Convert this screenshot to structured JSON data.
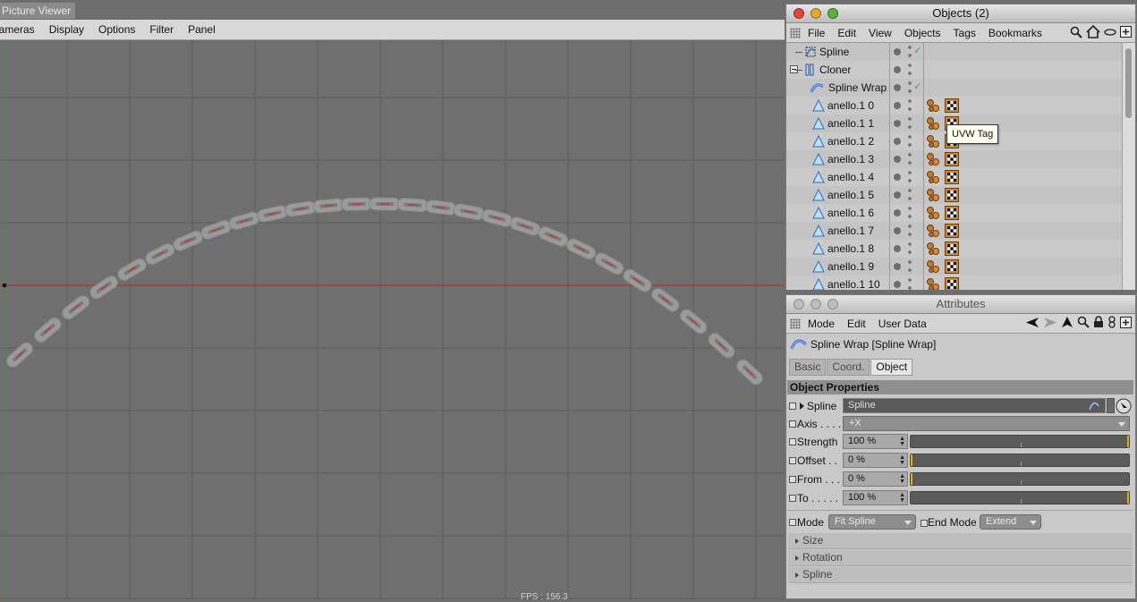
{
  "viewer": {
    "tab": "Picture Viewer",
    "fps": "FPS : 156.3"
  },
  "viewport_menu": [
    "Cameras",
    "Display",
    "Options",
    "Filter",
    "Panel"
  ],
  "objects_panel": {
    "title": "Objects (2)",
    "menu": [
      "File",
      "Edit",
      "View",
      "Objects",
      "Tags",
      "Bookmarks"
    ],
    "items": [
      {
        "name": "Spline",
        "icon": "spline-icon",
        "check": "✓"
      },
      {
        "name": "Cloner",
        "icon": "cloner-icon",
        "check": ""
      },
      {
        "name": "Spline Wrap",
        "icon": "spline-wrap-icon",
        "check": "✓"
      },
      {
        "name": "anello.1 0",
        "icon": "polygon-object-icon"
      },
      {
        "name": "anello.1 1",
        "icon": "polygon-object-icon"
      },
      {
        "name": "anello.1 2",
        "icon": "polygon-object-icon"
      },
      {
        "name": "anello.1 3",
        "icon": "polygon-object-icon"
      },
      {
        "name": "anello.1 4",
        "icon": "polygon-object-icon"
      },
      {
        "name": "anello.1 5",
        "icon": "polygon-object-icon"
      },
      {
        "name": "anello.1 6",
        "icon": "polygon-object-icon"
      },
      {
        "name": "anello.1 7",
        "icon": "polygon-object-icon"
      },
      {
        "name": "anello.1 8",
        "icon": "polygon-object-icon"
      },
      {
        "name": "anello.1 9",
        "icon": "polygon-object-icon"
      },
      {
        "name": "anello.1 10",
        "icon": "polygon-object-icon"
      }
    ],
    "tooltip": "UVW Tag"
  },
  "attributes_panel": {
    "title": "Attributes",
    "menu": [
      "Mode",
      "Edit",
      "User Data"
    ],
    "object_line": "Spline Wrap [Spline Wrap]",
    "tabs": [
      "Basic",
      "Coord.",
      "Object"
    ],
    "active_tab": "Object",
    "section": "Object Properties",
    "props": {
      "spline": {
        "label": "Spline",
        "value": "Spline"
      },
      "axis": {
        "label": "Axis . . . .",
        "value": "+X"
      },
      "strength": {
        "label": "Strength",
        "value": "100 %",
        "fraction": 1.0
      },
      "offset": {
        "label": "Offset . .",
        "value": "0 %",
        "fraction": 0.0
      },
      "from": {
        "label": "From . . .",
        "value": "0 %",
        "fraction": 0.0
      },
      "to": {
        "label": "To . . . . .",
        "value": "100 %",
        "fraction": 1.0
      },
      "mode": {
        "label": "Mode",
        "value": "Fit Spline"
      },
      "end_mode": {
        "label": "End Mode",
        "value": "Extend"
      }
    },
    "groups": [
      "Size",
      "Rotation",
      "Spline"
    ]
  }
}
